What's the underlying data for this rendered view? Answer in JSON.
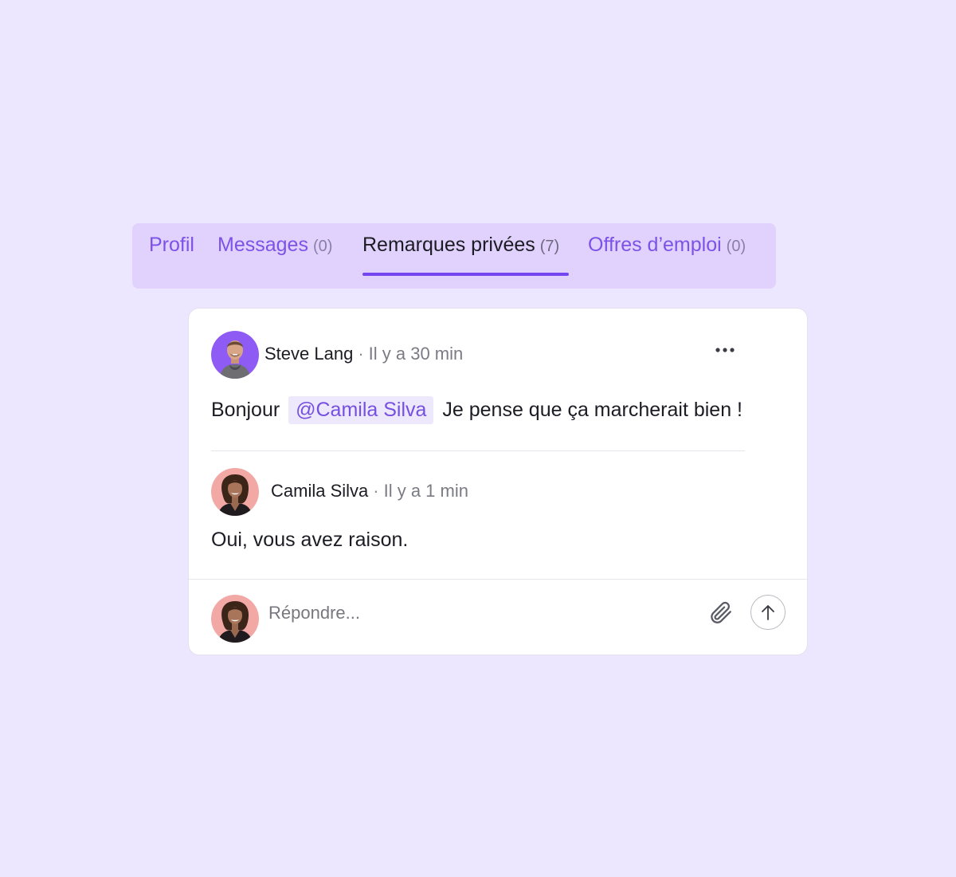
{
  "tabs": [
    {
      "label": "Profil",
      "count": ""
    },
    {
      "label": "Messages",
      "count": "(0)"
    },
    {
      "label": "Remarques privées",
      "count": "(7)"
    },
    {
      "label": "Offres d’emploi",
      "count": "(0)"
    }
  ],
  "active_tab": "Remarques privées",
  "comment": {
    "author": "Steve Lang",
    "separator": "·",
    "time": "Il y a 30 min",
    "text_before": "Bonjour",
    "mention": "@Camila Silva",
    "text_after": "Je pense que ça marcherait bien !"
  },
  "reply": {
    "author": "Camila Silva",
    "separator": "·",
    "time": "Il y a 1 min",
    "text": "Oui, vous avez raison."
  },
  "composer": {
    "placeholder": "Répondre..."
  },
  "icons": {
    "more": "more-horizontal-icon",
    "attach": "paperclip-icon",
    "send": "arrow-up-icon"
  },
  "colors": {
    "background": "#ede6ff",
    "tab_bar": "#e0d2fc",
    "accent": "#7446f0",
    "mention_bg": "#ede8fb",
    "steve_avatar_bg": "#8e5cf5",
    "camila_avatar_bg": "#f2a9a6"
  }
}
